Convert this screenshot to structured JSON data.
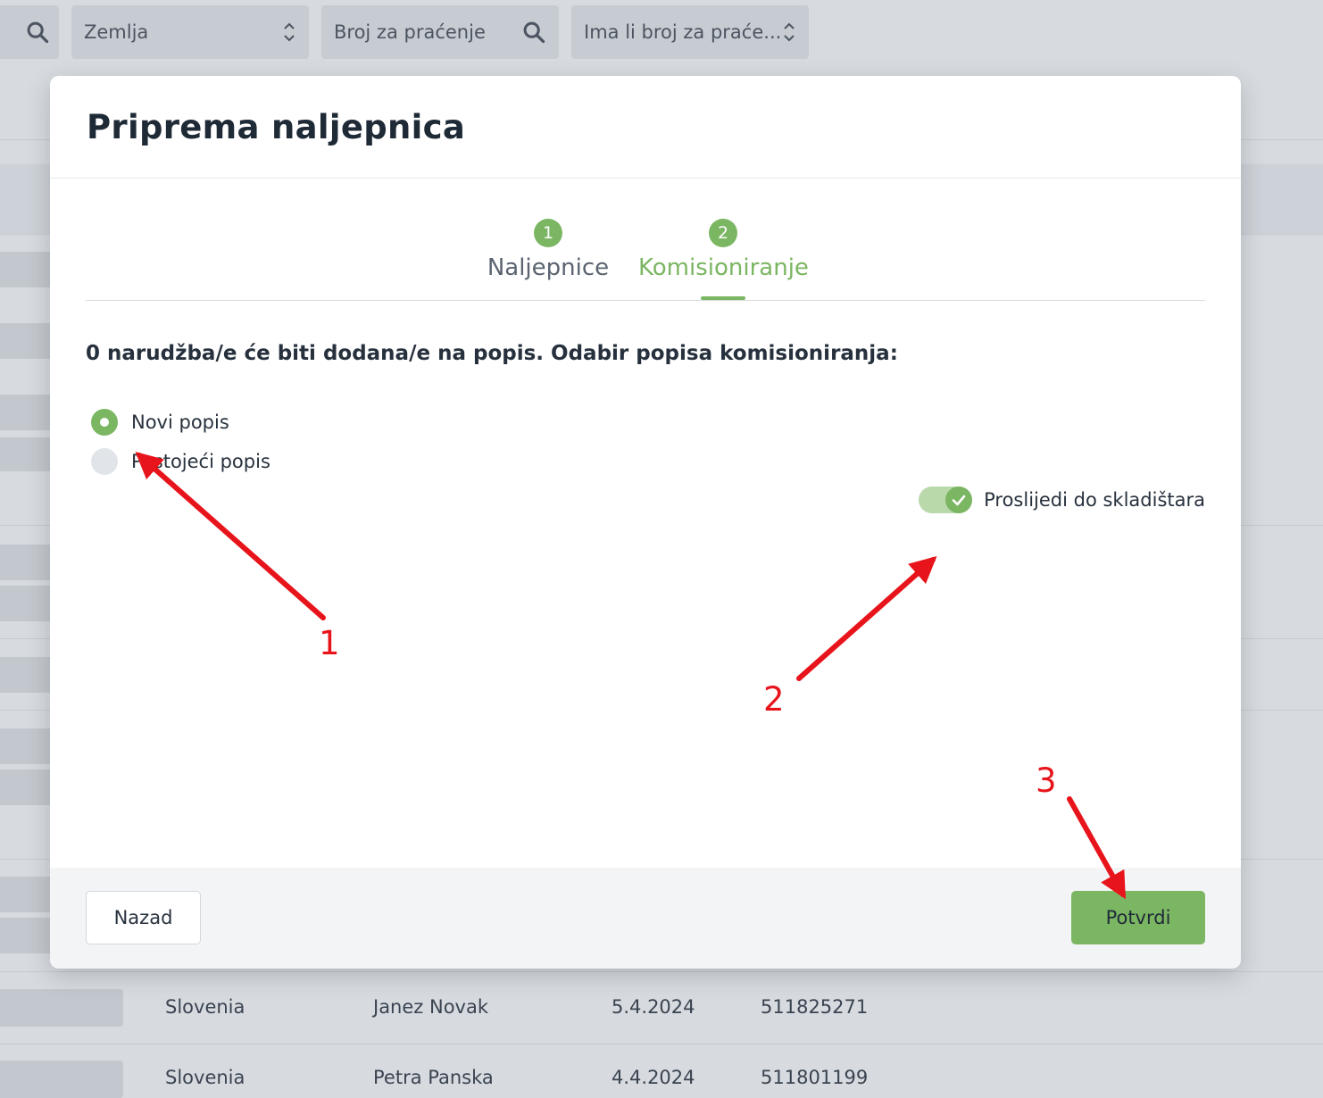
{
  "background": {
    "filters": [
      {
        "text": ""
      },
      {
        "text": "Zemlja"
      },
      {
        "text": "Broj za praćenje"
      },
      {
        "text": "Ima li broj za praće..."
      }
    ],
    "rows": [
      {
        "country": "Slovenia",
        "name": "Janez Novak",
        "date": "5.4.2024",
        "tracking": "511825271"
      },
      {
        "country": "Slovenia",
        "name": "Petra Panska",
        "date": "4.4.2024",
        "tracking": "511801199"
      }
    ]
  },
  "modal": {
    "title": "Priprema naljepnica",
    "steps": [
      {
        "number": "1",
        "label": "Naljepnice",
        "active": false
      },
      {
        "number": "2",
        "label": "Komisioniranje",
        "active": true
      }
    ],
    "instruction": "0 narudžba/e će biti dodana/e na popis. Odabir popisa komisioniranja:",
    "options": [
      {
        "label": "Novi popis",
        "selected": true
      },
      {
        "label": "Postojeći popis",
        "selected": false
      }
    ],
    "toggle": {
      "label": "Proslijedi do skladištara",
      "on": true
    },
    "footer": {
      "back_label": "Nazad",
      "confirm_label": "Potvrdi"
    }
  },
  "annotations": [
    "1",
    "2",
    "3"
  ],
  "colors": {
    "accent": "#7bb663",
    "annotation": "#e8141b"
  }
}
